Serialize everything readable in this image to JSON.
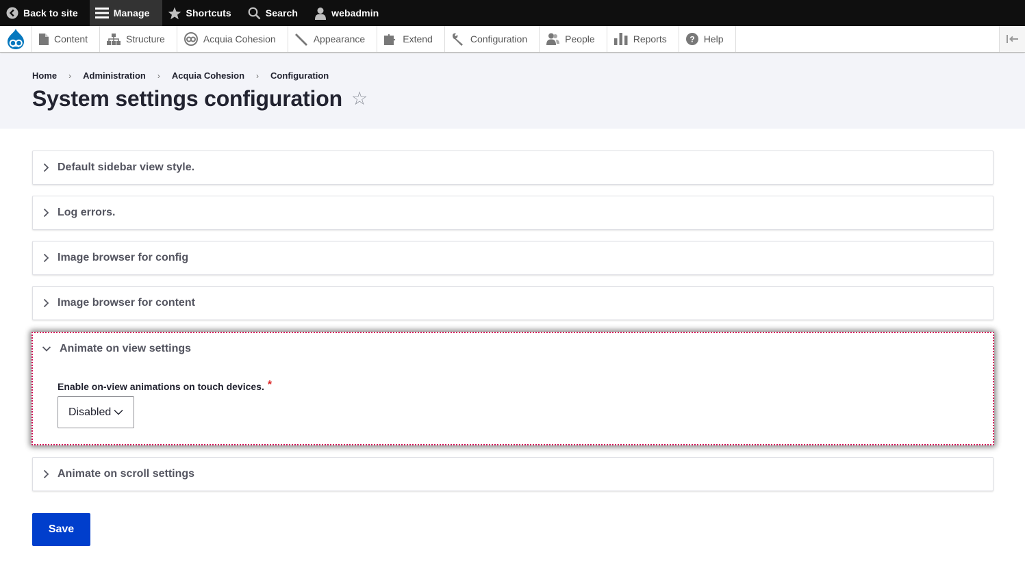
{
  "toolbar": {
    "back_label": "Back to site",
    "manage_label": "Manage",
    "shortcuts_label": "Shortcuts",
    "search_label": "Search",
    "user_label": "webadmin"
  },
  "tray": {
    "items": [
      {
        "label": "Content",
        "icon": "file-icon"
      },
      {
        "label": "Structure",
        "icon": "sitemap-icon"
      },
      {
        "label": "Acquia Cohesion",
        "icon": "cohesion-icon"
      },
      {
        "label": "Appearance",
        "icon": "paintbrush-icon"
      },
      {
        "label": "Extend",
        "icon": "puzzle-icon"
      },
      {
        "label": "Configuration",
        "icon": "wrench-icon"
      },
      {
        "label": "People",
        "icon": "people-icon"
      },
      {
        "label": "Reports",
        "icon": "bar-chart-icon"
      },
      {
        "label": "Help",
        "icon": "help-icon"
      }
    ]
  },
  "breadcrumb": [
    "Home",
    "Administration",
    "Acquia Cohesion",
    "Configuration"
  ],
  "page_title": "System settings configuration",
  "panels": [
    {
      "label": "Default sidebar view style.",
      "open": false
    },
    {
      "label": "Log errors.",
      "open": false
    },
    {
      "label": "Image browser for config",
      "open": false
    },
    {
      "label": "Image browser for content",
      "open": false
    },
    {
      "label": "Animate on view settings",
      "open": true
    },
    {
      "label": "Animate on scroll settings",
      "open": false
    }
  ],
  "animate_view": {
    "field_label": "Enable on-view animations on touch devices.",
    "required_mark": "*",
    "select_value": "Disabled"
  },
  "save_label": "Save",
  "colors": {
    "primary": "#003ecc",
    "focus_outline": "#d4145a",
    "required": "#dc2323",
    "toolbar_bg": "#0f0f0f",
    "drupal_blue": "#0678be"
  }
}
